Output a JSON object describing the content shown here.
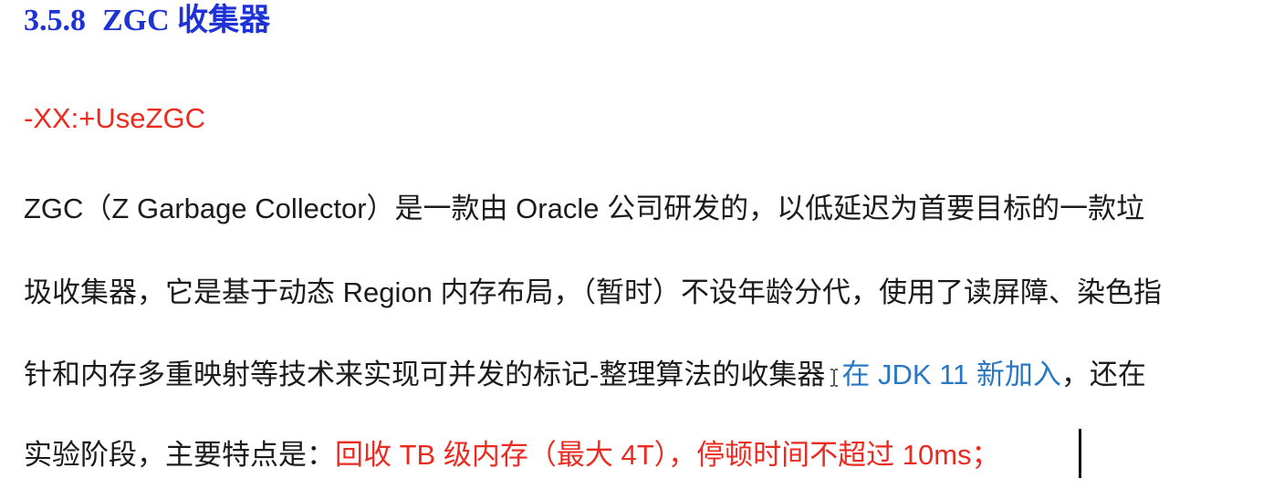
{
  "heading": {
    "number": "3.5.8",
    "title": "ZGC 收集器"
  },
  "flag": "-XX:+UseZGC",
  "paragraph": {
    "line1": "ZGC（Z Garbage Collector）是一款由 Oracle 公司研发的，以低延迟为首要目标的一款垃",
    "line2": "圾收集器，它是基于动态 Region 内存布局，（暂时）不设年龄分代，使用了读屏障、染色指",
    "line3_black": "针和内存多重映射等技术来实现可并发的标记-整理算法的收集器",
    "line3_blue": "在 JDK 11 新加入",
    "line3_tail": "，还在",
    "line4_black": "实验阶段，主要特点是：",
    "line4_red": "回收 TB 级内存（最大 4T），停顿时间不超过 10ms；"
  },
  "colors": {
    "heading": "#1e33d6",
    "flag": "#ec2b20",
    "body_text": "#1b1b1b",
    "highlight_blue": "#2a78c4",
    "highlight_red": "#ec2b20"
  },
  "icons": [
    "text-cursor-ibeam-icon",
    "text-insertion-caret"
  ]
}
